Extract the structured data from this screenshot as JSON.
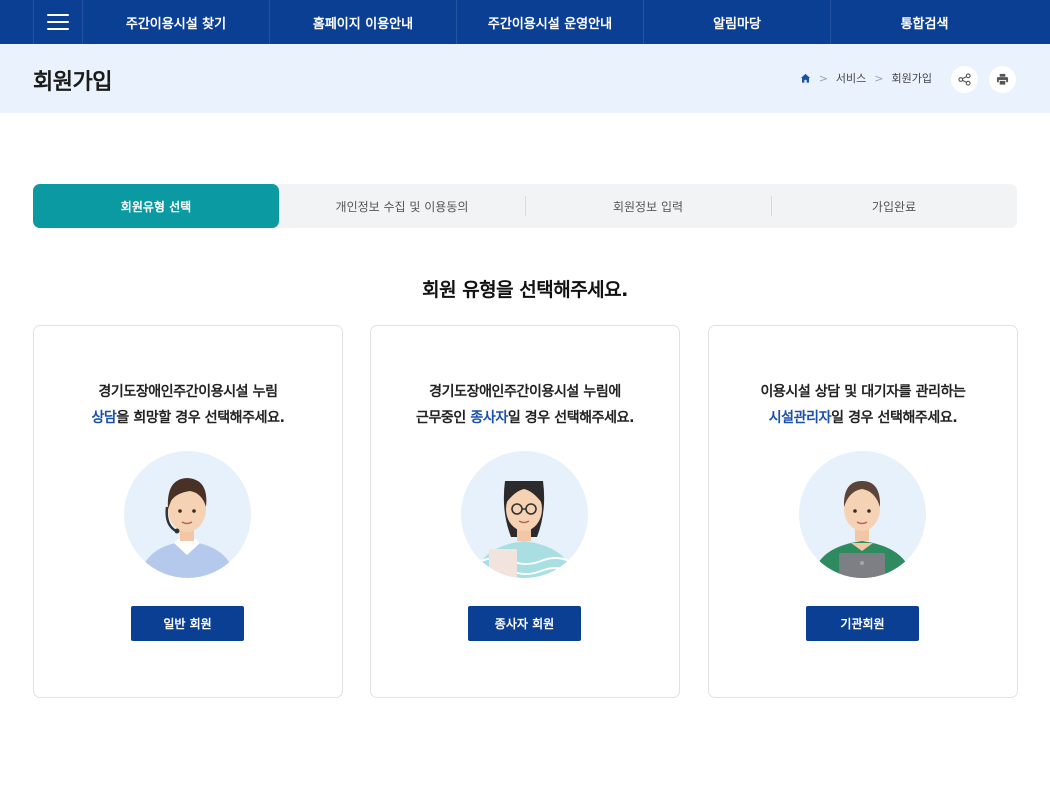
{
  "nav": {
    "menu_icon": "hamburger-menu-icon",
    "items": [
      "주간이용시설 찾기",
      "홈페이지 이용안내",
      "주간이용시설 운영안내",
      "알림마당",
      "통합검색"
    ]
  },
  "page": {
    "title": "회원가입",
    "breadcrumb": [
      "서비스",
      "회원가입"
    ],
    "home_icon": "home-icon",
    "share_icon": "share-icon",
    "print_icon": "print-icon"
  },
  "steps": [
    "회원유형 선택",
    "개인정보 수집 및 이용동의",
    "회원정보 입력",
    "가입완료"
  ],
  "heading": "회원 유형을 선택해주세요.",
  "cards": [
    {
      "line1": "경기도장애인주간이용시설 누림",
      "line2_highlight": "상담",
      "line2_rest": "을 희망할 경우 선택해주세요.",
      "image": "counselor-with-headset",
      "button": "일반 회원"
    },
    {
      "line1": "경기도장애인주간이용시설 누림에",
      "line2_prefix": "근무중인 ",
      "line2_highlight": "종사자",
      "line2_rest": "일 경우 선택해주세요.",
      "image": "staff-woman-with-glasses",
      "button": "종사자 회원"
    },
    {
      "line1": "이용시설 상담 및 대기자를 관리하는",
      "line2_highlight": "시설관리자",
      "line2_rest": "일 경우 선택해주세요.",
      "image": "manager-with-laptop",
      "button": "기관회원"
    }
  ],
  "colors": {
    "nav_bg": "#0a3f93",
    "header_bg": "#eaf3fd",
    "step_active": "#0b9aa1",
    "highlight": "#1a50a8",
    "button_bg": "#0a3f93"
  }
}
